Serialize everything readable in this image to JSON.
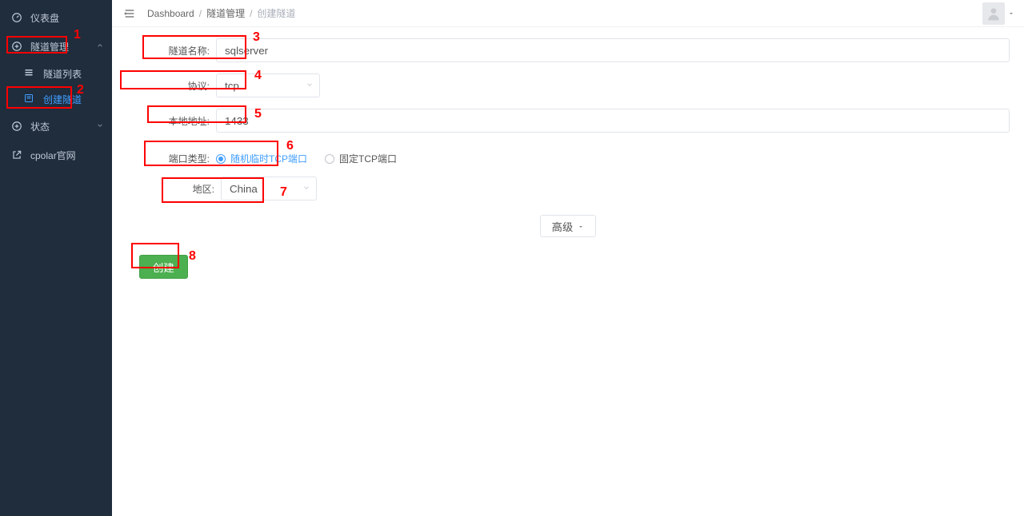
{
  "sidebar": {
    "items": [
      {
        "label": "仪表盘",
        "icon": "dashboard-icon"
      },
      {
        "label": "隧道管理",
        "icon": "plus-circle-icon",
        "expandable": true
      },
      {
        "label": "状态",
        "icon": "plus-circle-icon",
        "expandable": true
      },
      {
        "label": "cpolar官网",
        "icon": "external-icon"
      }
    ],
    "tunnel_children": [
      {
        "label": "隧道列表",
        "icon": "list-icon"
      },
      {
        "label": "创建隧道",
        "icon": "create-icon",
        "active": true
      }
    ]
  },
  "breadcrumb": {
    "root": "Dashboard",
    "mid": "隧道管理",
    "current": "创建隧道"
  },
  "form": {
    "name_label": "隧道名称:",
    "name_value": "sqlserver",
    "proto_label": "协议:",
    "proto_value": "tcp",
    "local_label": "本地地址:",
    "local_value": "1433",
    "port_type_label": "端口类型:",
    "port_random_label": "随机临时TCP端口",
    "port_fixed_label": "固定TCP端口",
    "region_label": "地区:",
    "region_value": "China",
    "advanced_label": "高级",
    "submit_label": "创建"
  },
  "annotations": {
    "n1": "1",
    "n2": "2",
    "n3": "3",
    "n4": "4",
    "n5": "5",
    "n6": "6",
    "n7": "7",
    "n8": "8"
  }
}
